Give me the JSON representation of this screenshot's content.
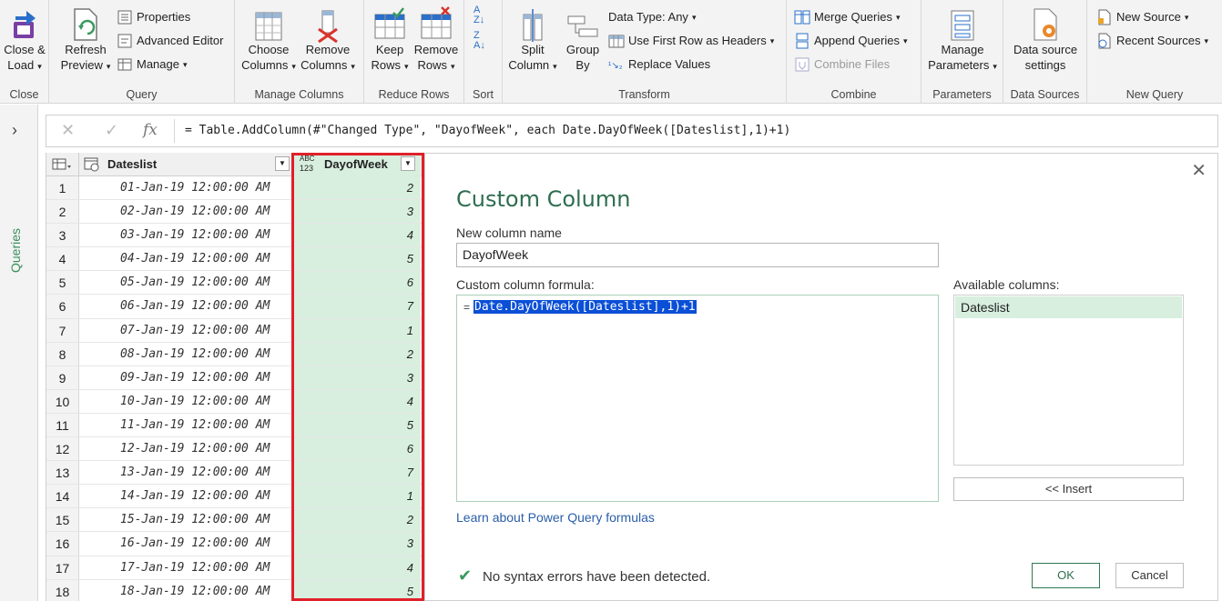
{
  "ribbon": {
    "close": {
      "label": "Close &\nLoad",
      "caret": "▾",
      "group": "Close"
    },
    "query": {
      "refresh": "Refresh\nPreview",
      "properties": "Properties",
      "advanced_editor": "Advanced Editor",
      "manage": "Manage",
      "group": "Query"
    },
    "manage_columns": {
      "choose": "Choose\nColumns",
      "remove": "Remove\nColumns",
      "group": "Manage Columns"
    },
    "reduce_rows": {
      "keep": "Keep\nRows",
      "remove": "Remove\nRows",
      "group": "Reduce Rows"
    },
    "sort": {
      "group": "Sort"
    },
    "transform": {
      "split": "Split\nColumn",
      "group_by": "Group\nBy",
      "data_type": "Data Type: Any",
      "first_row": "Use First Row as Headers",
      "replace": "Replace Values",
      "group": "Transform"
    },
    "combine": {
      "merge": "Merge Queries",
      "append": "Append Queries",
      "combine_files": "Combine Files",
      "group": "Combine"
    },
    "parameters": {
      "manage": "Manage\nParameters",
      "group": "Parameters"
    },
    "data_sources": {
      "settings": "Data source\nsettings",
      "group": "Data Sources"
    },
    "new_query": {
      "new_source": "New Source",
      "recent_sources": "Recent Sources",
      "group": "New Query"
    }
  },
  "rail": {
    "label": "Queries",
    "arrow": "›"
  },
  "formula_bar": {
    "cancel": "✕",
    "confirm": "✓",
    "fx": "fx",
    "text": "= Table.AddColumn(#\"Changed Type\", \"DayofWeek\", each Date.DayOfWeek([Dateslist],1)+1)"
  },
  "grid": {
    "columns": [
      {
        "name": "Dateslist",
        "type_icon": "datetime"
      },
      {
        "name": "DayofWeek",
        "type_icon": "ABC 123"
      }
    ],
    "rows": [
      {
        "n": "1",
        "date": "01-Jan-19 12:00:00 AM",
        "dow": "2"
      },
      {
        "n": "2",
        "date": "02-Jan-19 12:00:00 AM",
        "dow": "3"
      },
      {
        "n": "3",
        "date": "03-Jan-19 12:00:00 AM",
        "dow": "4"
      },
      {
        "n": "4",
        "date": "04-Jan-19 12:00:00 AM",
        "dow": "5"
      },
      {
        "n": "5",
        "date": "05-Jan-19 12:00:00 AM",
        "dow": "6"
      },
      {
        "n": "6",
        "date": "06-Jan-19 12:00:00 AM",
        "dow": "7"
      },
      {
        "n": "7",
        "date": "07-Jan-19 12:00:00 AM",
        "dow": "1"
      },
      {
        "n": "8",
        "date": "08-Jan-19 12:00:00 AM",
        "dow": "2"
      },
      {
        "n": "9",
        "date": "09-Jan-19 12:00:00 AM",
        "dow": "3"
      },
      {
        "n": "10",
        "date": "10-Jan-19 12:00:00 AM",
        "dow": "4"
      },
      {
        "n": "11",
        "date": "11-Jan-19 12:00:00 AM",
        "dow": "5"
      },
      {
        "n": "12",
        "date": "12-Jan-19 12:00:00 AM",
        "dow": "6"
      },
      {
        "n": "13",
        "date": "13-Jan-19 12:00:00 AM",
        "dow": "7"
      },
      {
        "n": "14",
        "date": "14-Jan-19 12:00:00 AM",
        "dow": "1"
      },
      {
        "n": "15",
        "date": "15-Jan-19 12:00:00 AM",
        "dow": "2"
      },
      {
        "n": "16",
        "date": "16-Jan-19 12:00:00 AM",
        "dow": "3"
      },
      {
        "n": "17",
        "date": "17-Jan-19 12:00:00 AM",
        "dow": "4"
      },
      {
        "n": "18",
        "date": "18-Jan-19 12:00:00 AM",
        "dow": "5"
      }
    ]
  },
  "dialog": {
    "title": "Custom Column",
    "close": "✕",
    "name_label": "New column name",
    "name_value": "DayofWeek",
    "formula_label": "Custom column formula:",
    "formula_eq": "=",
    "formula": "Date.DayOfWeek([Dateslist],1)+1",
    "available_label": "Available columns:",
    "available_columns": [
      "Dateslist"
    ],
    "insert": "<< Insert",
    "learn_link": "Learn about Power Query formulas",
    "status_icon": "✔",
    "status": "No syntax errors have been detected.",
    "ok": "OK",
    "cancel": "Cancel"
  },
  "colors": {
    "accent": "#2e6e50",
    "highlight_column": "#d8efdf",
    "selection": "#0a4fd6",
    "red_frame": "#e0202a"
  }
}
